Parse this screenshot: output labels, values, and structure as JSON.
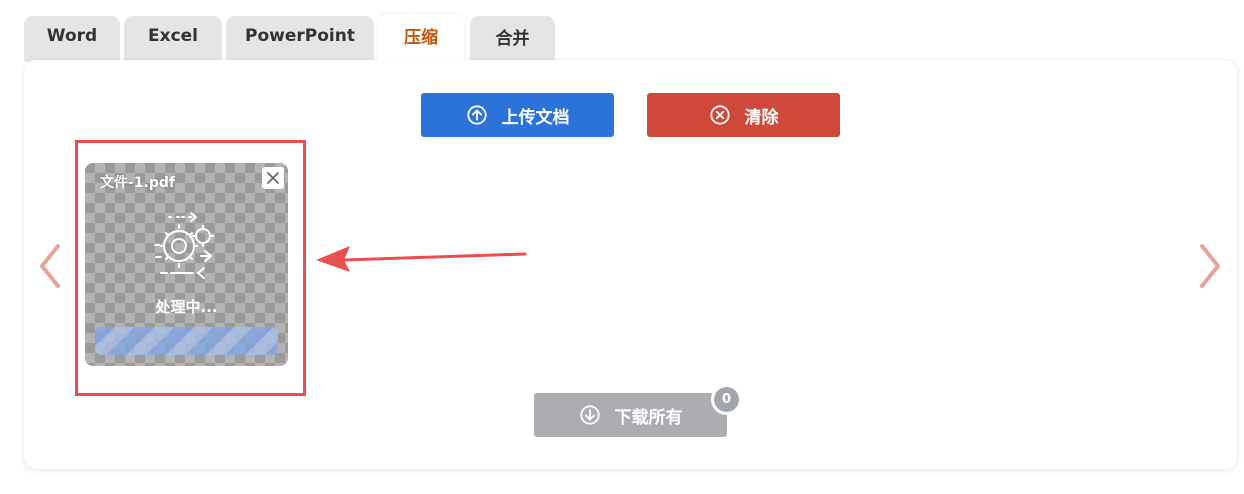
{
  "tabs": [
    {
      "label": "Word",
      "active": false
    },
    {
      "label": "Excel",
      "active": false
    },
    {
      "label": "PowerPoint",
      "active": false
    },
    {
      "label": "压缩",
      "active": true
    },
    {
      "label": "合并",
      "active": false
    }
  ],
  "toolbar": {
    "upload_label": "上传文档",
    "upload_icon": "arrow-up-circle-icon",
    "clear_label": "清除",
    "clear_icon": "x-circle-icon"
  },
  "file": {
    "name": "文件-1.pdf",
    "status": "处理中...",
    "status_icon": "gears-icon"
  },
  "download": {
    "label": "下载所有",
    "icon": "arrow-down-circle-icon",
    "count": "0"
  },
  "colors": {
    "upload": "#2b73d9",
    "clear": "#d0483a",
    "download_disabled": "#abadb1",
    "active_tab_text": "#c2570c",
    "highlight": "#ea4e4e"
  }
}
